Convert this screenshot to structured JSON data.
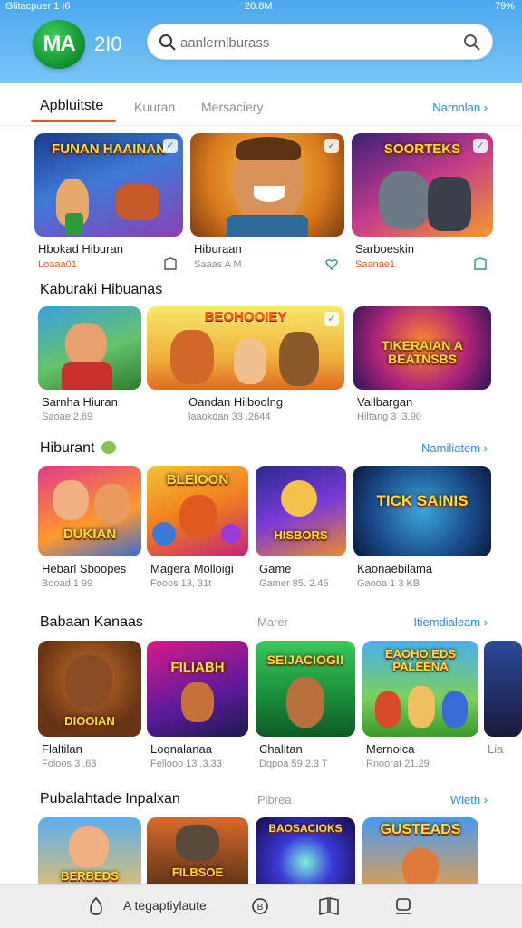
{
  "status": {
    "left": "Glitacpuer 1 I6",
    "center": "20.8M",
    "right": "79%"
  },
  "header": {
    "logo": "MA",
    "app_name": "2I0",
    "search_placeholder": "aanlernlburass"
  },
  "tabs": {
    "items": [
      "Apbluitste",
      "Kuuran",
      "Mersaciery"
    ],
    "link": "Narnnlan ›"
  },
  "sections": [
    {
      "title": "",
      "link": "",
      "mid": "",
      "cards": [
        {
          "art": "FUNAN HAAINAN",
          "title": "Hbokad Hiburan",
          "sub": "Loaaa01",
          "sub_orange": true
        },
        {
          "art": "",
          "title": "Hiburaan",
          "sub": "Saaas A M",
          "sub_orange": false
        },
        {
          "art": "SOORTEKS",
          "title": "Sarboeskin",
          "sub": "Saanae1",
          "sub_orange": true
        }
      ]
    },
    {
      "title": "Kaburaki Hibuanas",
      "link": "",
      "mid": "",
      "cards": [
        {
          "art": "",
          "title": "Sarnha Hiuran",
          "sub": "Saoae.2.69"
        },
        {
          "art": "BEOHOOIEY",
          "title": "Oandan Hilboolng",
          "sub": "laaokdan 33 .2644"
        },
        {
          "art": "TIKERAIAN A BEATNSBS",
          "title": "Vallbargan",
          "sub": "Hiltang 3 .3.90"
        }
      ]
    },
    {
      "title": "Hiburant",
      "link": "Namiliatem ›",
      "mid": "",
      "cards": [
        {
          "art": "DUKIAN",
          "title": "Hebarl Sboopes",
          "sub": "Booad 1 99"
        },
        {
          "art": "BLEIOON",
          "title": "Magera Molloigi",
          "sub": "Fooos 13, 31t"
        },
        {
          "art": "HISBORS",
          "title": "Game",
          "sub": "Gamer 85. 2.45"
        },
        {
          "art": "TICK SAINIS",
          "title": "Kaonaebilama",
          "sub": "Gaooa 1 3 KB"
        }
      ]
    },
    {
      "title": "Babaan Kanaas",
      "link": "Itiemdialeam ›",
      "mid": "Marer",
      "cards": [
        {
          "art": "DIOOIAN",
          "title": "Flaltilan",
          "sub": "Foloos 3 .63"
        },
        {
          "art": "FILIABH",
          "title": "Loqnalanaa",
          "sub": "Fellooo 13 .3.33"
        },
        {
          "art": "SEIJACIOGI!",
          "title": "Chalitan",
          "sub": "Dqpoa 59 2.3 T"
        },
        {
          "art": "EAOHOIEDS PALEENA",
          "title": "Mernoica",
          "sub": "Rnoorat 21.29"
        },
        {
          "art": "",
          "title": "Lia",
          "sub": ""
        }
      ]
    },
    {
      "title": "Pubalahtade Inpalxan",
      "link": "Wieth ›",
      "mid": "Pibrea",
      "cards": [
        {
          "art": "BERBEDS",
          "title": "",
          "sub": ""
        },
        {
          "art": "FILBSOE",
          "title": "",
          "sub": ""
        },
        {
          "art": "BAOSACIOKS",
          "title": "",
          "sub": ""
        },
        {
          "art": "GUSTEADS",
          "title": "",
          "sub": ""
        }
      ]
    }
  ],
  "bottom": {
    "label": "A tegaptiylaute"
  },
  "colors": {
    "accent": "#2a8be6",
    "tab_underline": "#e8551c",
    "header": "#4aa9ee"
  }
}
